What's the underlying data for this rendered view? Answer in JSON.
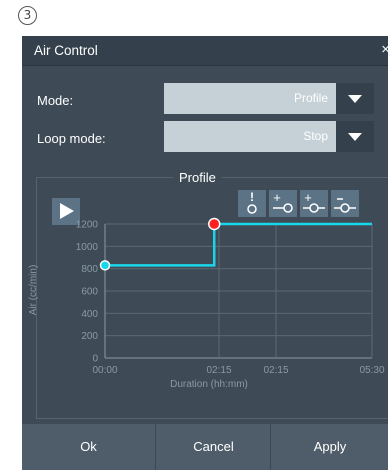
{
  "step_marker": "3",
  "dialog": {
    "title": "Air Control",
    "close_glyph": "×"
  },
  "form": {
    "mode_label": "Mode:",
    "mode_value": "Profile",
    "loop_label": "Loop mode:",
    "loop_value": "Stop"
  },
  "profile": {
    "title": "Profile",
    "tools": [
      {
        "icon": "alert-point-icon"
      },
      {
        "icon": "add-point-icon"
      },
      {
        "icon": "insert-point-icon"
      },
      {
        "icon": "remove-point-icon"
      }
    ]
  },
  "colors": {
    "dialog_bg": "#3e4b56",
    "line": "#19d7ea",
    "point_normal": "#19d7ea",
    "point_selected": "#ff2020",
    "button_blue": "#5b7385"
  },
  "chart_data": {
    "type": "line",
    "xlabel": "Duration (hh:mm)",
    "ylabel": "Air (cc/min)",
    "x_tick_labels": [
      "00:00",
      "02:15",
      "02:15",
      "05:30"
    ],
    "y_ticks": [
      0,
      200,
      400,
      600,
      800,
      1000,
      1200
    ],
    "ylim": [
      0,
      1200
    ],
    "xlim_minutes": [
      0,
      330
    ],
    "series": [
      {
        "values": [
          {
            "x": "00:00",
            "y": 830
          },
          {
            "x": "02:15",
            "y": 830
          },
          {
            "x": "02:15",
            "y": 1200
          },
          {
            "x": "05:30",
            "y": 1200
          }
        ]
      }
    ],
    "points": [
      {
        "x": "00:00",
        "y": 830,
        "selected": false
      },
      {
        "x": "02:15",
        "y": 1200,
        "selected": true
      }
    ],
    "grid": true
  },
  "buttons": {
    "ok": "Ok",
    "cancel": "Cancel",
    "apply": "Apply"
  }
}
